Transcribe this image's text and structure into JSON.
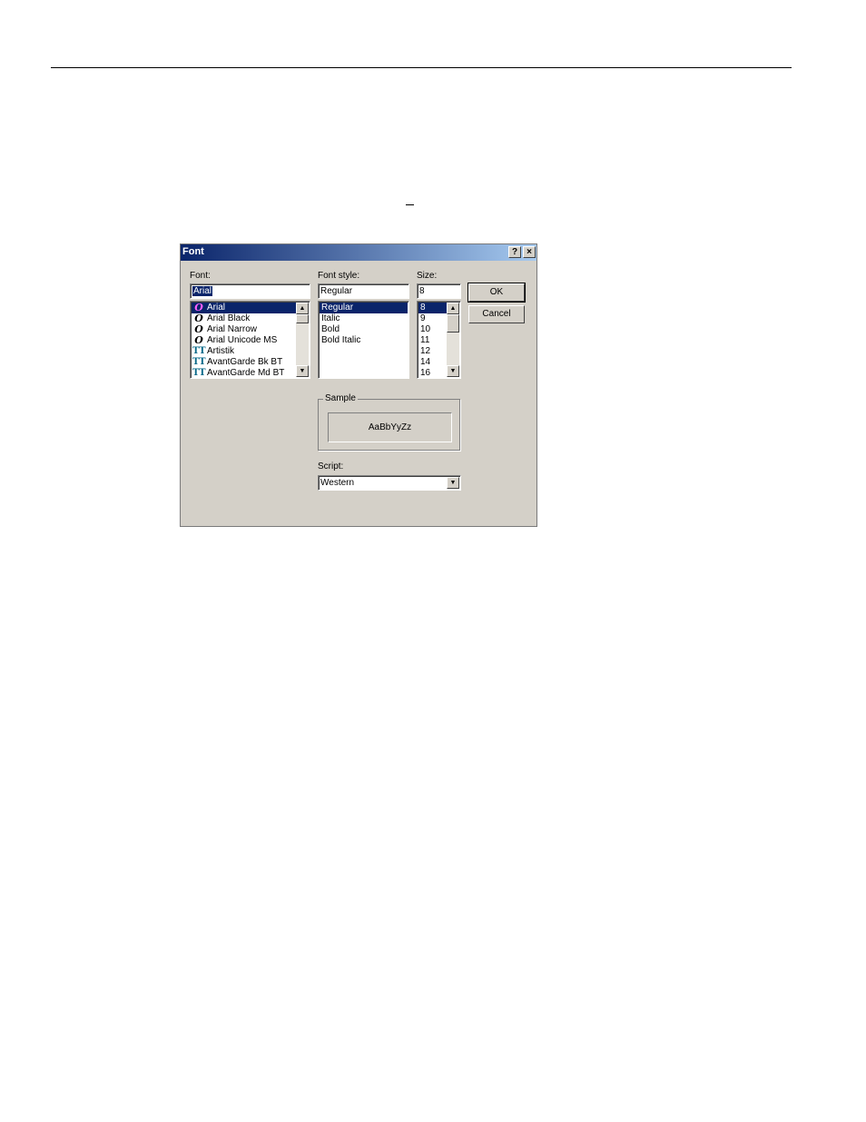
{
  "dialog": {
    "title": "Font",
    "help_glyph": "?",
    "close_glyph": "×",
    "font_label": "Font:",
    "font_value": "Arial",
    "style_label": "Font style:",
    "style_value": "Regular",
    "size_label": "Size:",
    "size_value": "8",
    "ok_label": "OK",
    "cancel_label": "Cancel",
    "sample_label": "Sample",
    "sample_text": "AaBbYyZz",
    "script_label": "Script:",
    "script_value": "Western"
  },
  "font_list": [
    {
      "name": "Arial",
      "icon": "opentype-font-icon",
      "glyph": "O",
      "selected": true
    },
    {
      "name": "Arial Black",
      "icon": "opentype-font-icon",
      "glyph": "O",
      "selected": false
    },
    {
      "name": "Arial Narrow",
      "icon": "opentype-font-icon",
      "glyph": "O",
      "selected": false
    },
    {
      "name": "Arial Unicode MS",
      "icon": "opentype-font-icon",
      "glyph": "O",
      "selected": false
    },
    {
      "name": "Artistik",
      "icon": "truetype-font-icon",
      "glyph": "TT",
      "selected": false
    },
    {
      "name": "AvantGarde Bk BT",
      "icon": "truetype-font-icon",
      "glyph": "TT",
      "selected": false
    },
    {
      "name": "AvantGarde Md BT",
      "icon": "truetype-font-icon",
      "glyph": "TT",
      "selected": false
    }
  ],
  "style_list": [
    {
      "name": "Regular",
      "selected": true
    },
    {
      "name": "Italic",
      "selected": false
    },
    {
      "name": "Bold",
      "selected": false
    },
    {
      "name": "Bold Italic",
      "selected": false
    }
  ],
  "size_list": [
    {
      "name": "8",
      "selected": true
    },
    {
      "name": "9",
      "selected": false
    },
    {
      "name": "10",
      "selected": false
    },
    {
      "name": "11",
      "selected": false
    },
    {
      "name": "12",
      "selected": false
    },
    {
      "name": "14",
      "selected": false
    },
    {
      "name": "16",
      "selected": false
    }
  ],
  "scroll_glyphs": {
    "up": "▲",
    "down": "▼"
  },
  "colors": {
    "titlebar_start": "#0a246a",
    "titlebar_end": "#a6caf0",
    "dialog_face": "#d4d0c8",
    "selection": "#0a246a"
  }
}
